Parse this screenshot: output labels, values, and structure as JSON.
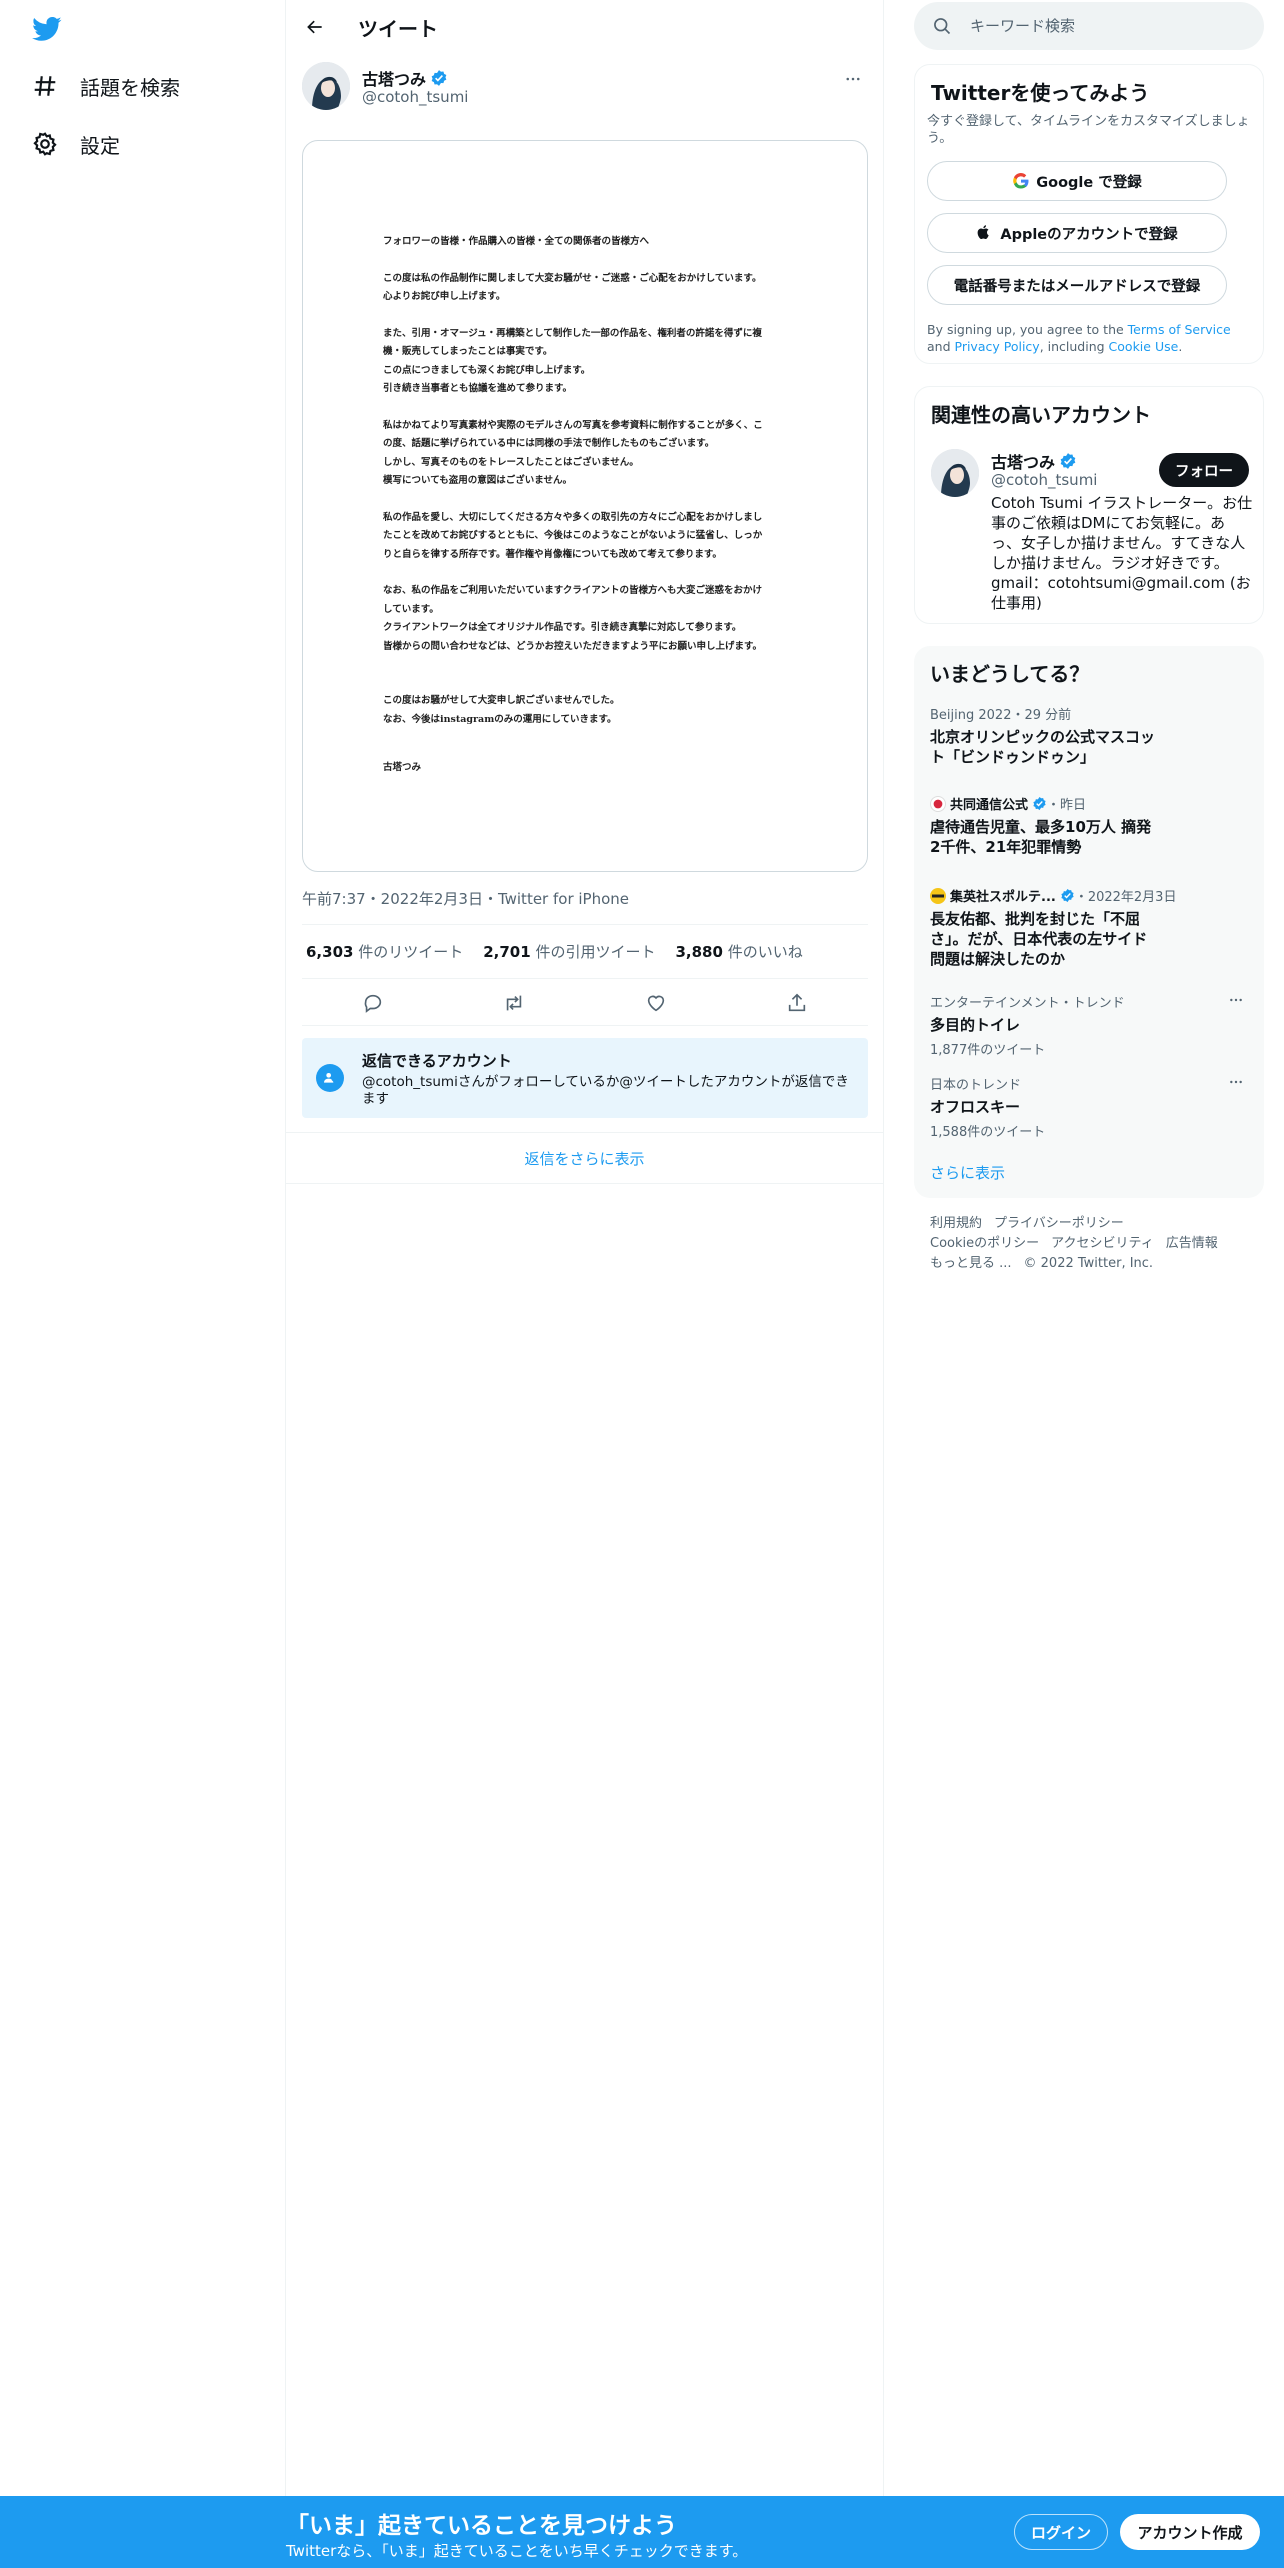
{
  "nav": {
    "items": [
      {
        "label": "話題を検索",
        "icon": "hashtag-icon"
      },
      {
        "label": "設定",
        "icon": "gear-icon"
      }
    ]
  },
  "header": {
    "title": "ツイート"
  },
  "tweet": {
    "author_name": "古塔つみ",
    "author_handle": "@cotoh_tsumi",
    "document_lines": [
      "フォロワーの皆様・作品購入の皆様・全ての関係者の皆様方へ",
      "この度は私の作品制作に関しまして大変お騒がせ・ご迷惑・ご心配をおかけしています。\n心よりお詫び申し上げます。",
      "また、引用・オマージュ・再構築として制作した一部の作品を、権利者の許諾を得ずに複\n機・販売してしまったことは事実です。\nこの点につきましても深くお詫び申し上げます。\n引き続き当事者とも協議を進めて参ります。",
      "私はかねてより写真素材や実際のモデルさんの写真を参考資料に制作することが多く、こ\nの度、話題に挙げられている中には同様の手法で制作したものもございます。\nしかし、写真そのものをトレースしたことはございません。\n模写についても盗用の意図はございません。",
      "私の作品を愛し、大切にしてくださる方々や多くの取引先の方々にご心配をおかけしまし\nたことを改めてお詫びするとともに、今後はこのようなことがないように猛省し、しっか\nりと自らを律する所存です。著作権や肖像権についても改めて考えて参ります。",
      "なお、私の作品をご利用いただいていますクライアントの皆様方へも大変ご迷惑をおかけ\nしています。\nクライアントワークは全てオリジナル作品です。引き続き真摯に対応して参ります。\n皆様からの問い合わせなどは、どうかお控えいただきますよう平にお願い申し上げます。",
      "この度はお騒がせして大変申し訳ございませんでした。\nなお、今後はinstagramのみの運用にしていきます。",
      "古塔つみ"
    ],
    "meta": "午前7:37・2022年2月3日・Twitter for iPhone",
    "retweets": "6,303",
    "retweets_label": " 件のリツイート",
    "quotes": "2,701",
    "quotes_label": " 件の引用ツイート",
    "likes": "3,880",
    "likes_label": " 件のいいね",
    "reply_title": "返信できるアカウント",
    "reply_text": "@cotoh_tsumiさんがフォローしているか@ツイートしたアカウントが返信できます",
    "show_more": "返信をさらに表示"
  },
  "search": {
    "placeholder": "キーワード検索"
  },
  "signup": {
    "title": "Twitterを使ってみよう",
    "subtitle": "今すぐ登録して、タイムラインをカスタマイズしましょう。",
    "google": "Google で登録",
    "apple": "Appleのアカウントで登録",
    "phone": "電話番号またはメールアドレスで登録",
    "terms_pre": "By signing up, you agree to the ",
    "terms_tos": "Terms of Service",
    "terms_and": " and ",
    "terms_pp": "Privacy Policy",
    "terms_inc": ", including ",
    "terms_cookie": "Cookie Use",
    "terms_end": "."
  },
  "related": {
    "title": "関連性の高いアカウント",
    "name": "古塔つみ",
    "handle": "@cotoh_tsumi",
    "follow": "フォロー",
    "bio": "Cotoh Tsumi イラストレーター。お仕事のご依頼はDMにてお気軽に。あっ、女子しか描けません。すてきな人しか描けません。ラジオ好きです。gmail：cotohtsumi@gmail.com (お仕事用)"
  },
  "trends": {
    "title": "いまどうしてる？",
    "items": [
      {
        "category": "Beijing 2022・29 分前",
        "title": "北京オリンピックの公式マスコット「ビンドゥンドゥン」",
        "count": ""
      },
      {
        "category": "共同通信公式",
        "category_suffix": "・昨日",
        "title": "虐待通告児童、最多10万人 摘発2千件、21年犯罪情勢",
        "count": ""
      },
      {
        "category": "集英社スポルテ...",
        "category_suffix": "・2022年2月3日",
        "title": "長友佑都、批判を封じた「不屈さ」。だが、日本代表の左サイド問題は解決したのか",
        "count": ""
      },
      {
        "category": "エンターテインメント・トレンド",
        "title": "多目的トイレ",
        "count": "1,877件のツイート"
      },
      {
        "category": "日本のトレンド",
        "title": "オフロスキー",
        "count": "1,588件のツイート"
      }
    ],
    "show_more": "さらに表示"
  },
  "footer": {
    "links": [
      "利用規約",
      "プライバシーポリシー",
      "Cookieのポリシー",
      "アクセシビリティ",
      "広告情報",
      "もっと見る ...",
      "© 2022 Twitter, Inc."
    ]
  },
  "bottom": {
    "title": "「いま」起きていることを見つけよう",
    "subtitle": "Twitterなら、「いま」起きていることをいち早くチェックできます。",
    "login": "ログイン",
    "signup": "アカウント作成"
  },
  "colors": {
    "accent": "#1d9bf0",
    "text": "#0f1419",
    "muted": "#536471"
  }
}
